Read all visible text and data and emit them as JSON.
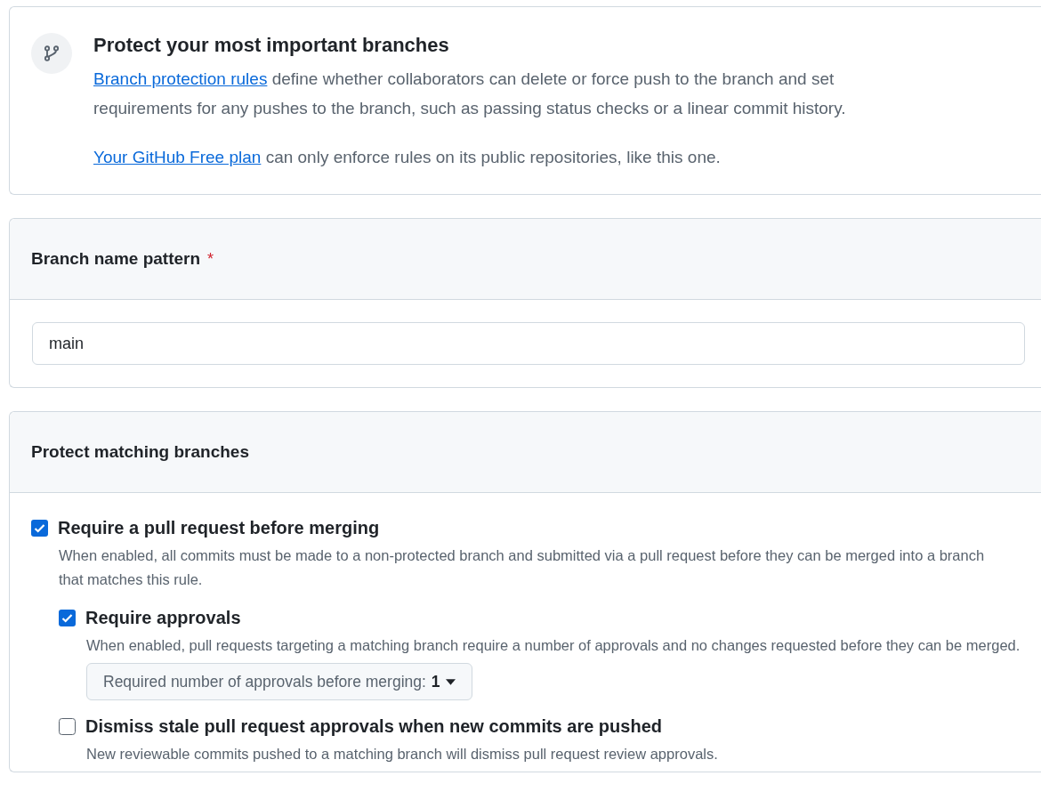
{
  "intro": {
    "title": "Protect your most important branches",
    "paragraphs": [
      {
        "link": "Branch protection rules",
        "text": " define whether collaborators can delete or force push to the branch and set requirements for any pushes to the branch, such as passing status checks or a linear commit history."
      },
      {
        "link": "Your GitHub Free plan",
        "text": " can only enforce rules on its public repositories, like this one."
      }
    ]
  },
  "pattern": {
    "label": "Branch name pattern",
    "required_mark": "*",
    "value": "main"
  },
  "protect": {
    "title": "Protect matching branches",
    "options": [
      {
        "label": "Require a pull request before merging",
        "checked": true,
        "description": "When enabled, all commits must be made to a non-protected branch and submitted via a pull request before they can be merged into a branch that matches this rule.",
        "children": [
          {
            "label": "Require approvals",
            "checked": true,
            "description": "When enabled, pull requests targeting a matching branch require a number of approvals and no changes requested before they can be merged.",
            "dropdown": {
              "label": "Required number of approvals before merging:",
              "value": "1"
            }
          },
          {
            "label": "Dismiss stale pull request approvals when new commits are pushed",
            "checked": false,
            "description": "New reviewable commits pushed to a matching branch will dismiss pull request review approvals."
          }
        ]
      }
    ]
  }
}
